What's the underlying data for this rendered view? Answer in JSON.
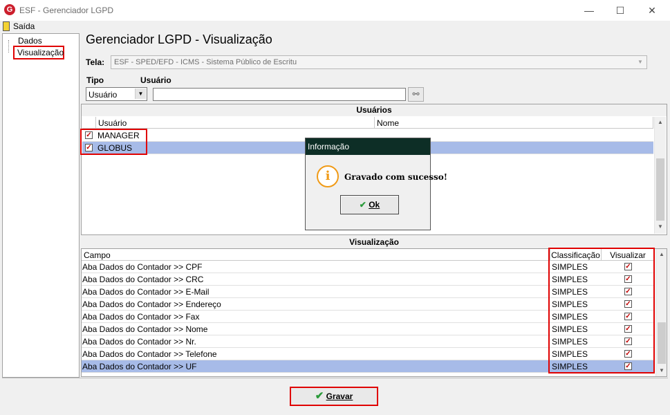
{
  "window": {
    "title": "ESF - Gerenciador LGPD",
    "icon_letter": "G",
    "minimize": "—",
    "maximize": "☐",
    "close": "✕"
  },
  "menu": {
    "exit_label": "Saída"
  },
  "tree": {
    "items": [
      "Dados",
      "Visualização"
    ]
  },
  "page": {
    "heading": "Gerenciador LGPD - Visualização"
  },
  "tela": {
    "label": "Tela:",
    "value": "ESF - SPED/EFD - ICMS - Sistema Público de Escritu"
  },
  "filters": {
    "tipo_label": "Tipo",
    "usuario_label": "Usuário",
    "tipo_value": "Usuário",
    "usuario_value": ""
  },
  "users": {
    "caption": "Usuários",
    "columns": [
      "Usuário",
      "Nome"
    ],
    "rows": [
      {
        "user": "MANAGER",
        "name": "",
        "checked": true
      },
      {
        "user": "GLOBUS",
        "name": "",
        "checked": true,
        "selected": true
      }
    ]
  },
  "visualizacao": {
    "caption": "Visualização",
    "columns": [
      "Campo",
      "Classificação",
      "Visualizar"
    ],
    "rows": [
      {
        "campo": "Aba Dados do Contador >> CPF",
        "classificacao": "SIMPLES",
        "visualizar": true
      },
      {
        "campo": "Aba Dados do Contador >> CRC",
        "classificacao": "SIMPLES",
        "visualizar": true
      },
      {
        "campo": "Aba Dados do Contador >> E-Mail",
        "classificacao": "SIMPLES",
        "visualizar": true
      },
      {
        "campo": "Aba Dados do Contador >> Endereço",
        "classificacao": "SIMPLES",
        "visualizar": true
      },
      {
        "campo": "Aba Dados do Contador >> Fax",
        "classificacao": "SIMPLES",
        "visualizar": true
      },
      {
        "campo": "Aba Dados do Contador >> Nome",
        "classificacao": "SIMPLES",
        "visualizar": true
      },
      {
        "campo": "Aba Dados do Contador >> Nr.",
        "classificacao": "SIMPLES",
        "visualizar": true
      },
      {
        "campo": "Aba Dados do Contador >> Telefone",
        "classificacao": "SIMPLES",
        "visualizar": true
      },
      {
        "campo": "Aba Dados do Contador >> UF",
        "classificacao": "SIMPLES",
        "visualizar": true,
        "selected": true
      }
    ]
  },
  "dialog": {
    "title": "Informação",
    "icon": "i",
    "message": "Gravado com sucesso!",
    "ok_label": "Ok"
  },
  "footer": {
    "save_label": "Gravar"
  },
  "colors": {
    "highlight": "#a7bbe8",
    "annotation_red": "#e00000",
    "dialog_title_bg": "#0d2e26",
    "info_orange": "#f09a16",
    "check_green": "#2a9a3a"
  }
}
